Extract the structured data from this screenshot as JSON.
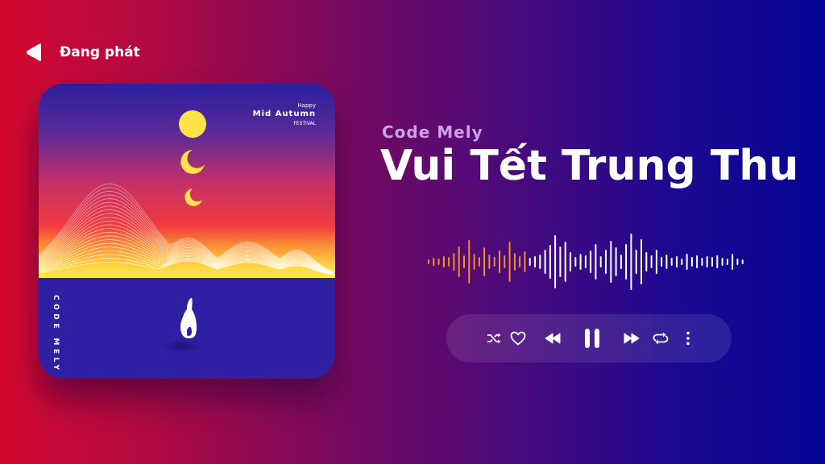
{
  "header": {
    "back_icon": "back-triangle-icon",
    "now_playing_label": "Đang phát"
  },
  "album_art": {
    "happy_text": "Happy",
    "mid_autumn_text": "Mid Autumn",
    "festival_text": "FESTIVAL",
    "vertical_brand": "CODE MELY",
    "moon_phases": [
      "full-moon",
      "crescent",
      "crescent"
    ],
    "icon_name": "rabbit-icon",
    "colors": {
      "top": "#2b1fa0",
      "mid": "#e03a55",
      "horizon": "#ffd23a",
      "ground": "#2f1fa3",
      "moon": "#ffe14a"
    }
  },
  "track": {
    "artist": "Code Mely",
    "title": "Vui Tết Trung Thu"
  },
  "waveform": {
    "played_color": "#f0902a",
    "unplayed_color": "#ffffff",
    "played_bars": 20,
    "bars": [
      6,
      10,
      8,
      14,
      12,
      22,
      38,
      16,
      54,
      20,
      12,
      36,
      18,
      12,
      28,
      16,
      50,
      22,
      14,
      26,
      10,
      14,
      18,
      30,
      42,
      66,
      38,
      50,
      24,
      12,
      20,
      16,
      28,
      44,
      14,
      30,
      52,
      36,
      18,
      44,
      70,
      30,
      56,
      24,
      16,
      30,
      12,
      18,
      10,
      14,
      8,
      20,
      12,
      16,
      10,
      14,
      12,
      16,
      10,
      8,
      20,
      8,
      6
    ]
  },
  "controls": {
    "shuffle_icon": "shuffle-icon",
    "like_icon": "heart-icon",
    "previous_icon": "previous-icon",
    "pause_icon": "pause-icon",
    "next_icon": "next-icon",
    "repeat_icon": "repeat-icon",
    "more_icon": "more-vertical-icon"
  }
}
